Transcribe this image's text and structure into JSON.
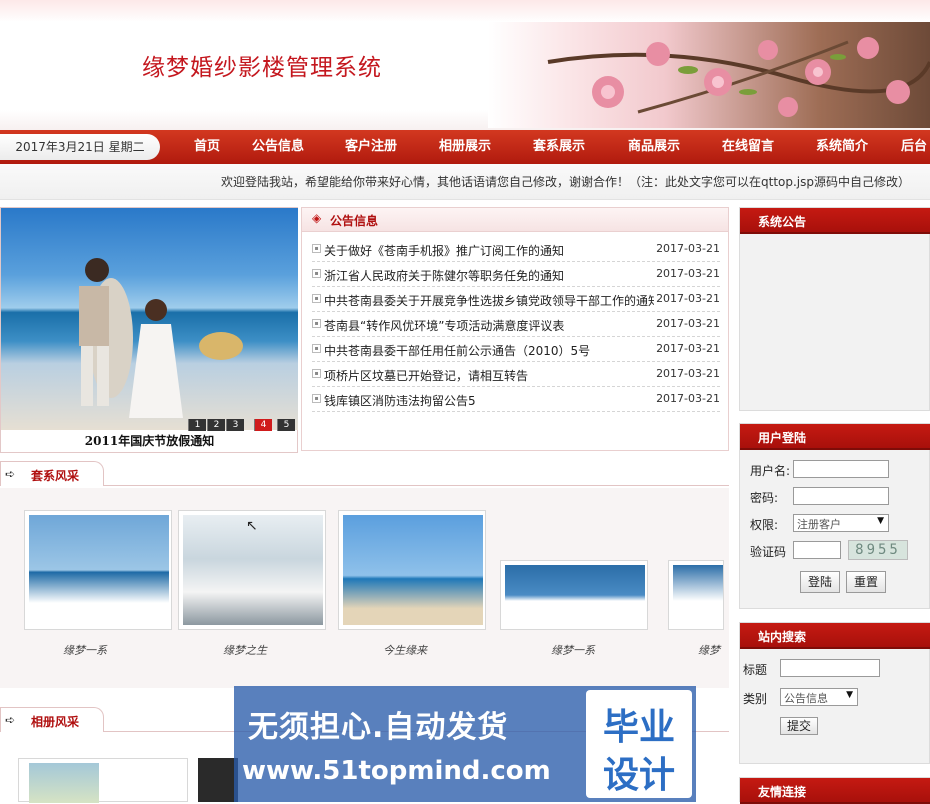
{
  "header": {
    "site_title": "缘梦婚纱影楼管理系统"
  },
  "nav": {
    "date": "2017年3月21日 星期二",
    "items": [
      "首页",
      "公告信息",
      "客户注册",
      "相册展示",
      "套系展示",
      "商品展示",
      "在线留言",
      "系统简介",
      "后台"
    ]
  },
  "notice": {
    "text": "欢迎登陆我站，希望能给你带来好心情，其他话语请您自己修改，谢谢合作！（注：此处文字您可以在qttop.jsp源码中自己修改）"
  },
  "slideshow": {
    "caption": "2011年国庆节放假通知",
    "pages": [
      "1",
      "2",
      "3",
      "4",
      "5"
    ],
    "active_page": "4"
  },
  "announcements": {
    "title": "公告信息",
    "items": [
      {
        "title": "关于做好《苍南手机报》推广订阅工作的通知",
        "date": "2017-03-21"
      },
      {
        "title": "浙江省人民政府关于陈健尔等职务任免的通知",
        "date": "2017-03-21"
      },
      {
        "title": "中共苍南县委关于开展竞争性选拔乡镇党政领导干部工作的通知",
        "date": "2017-03-21"
      },
      {
        "title": "苍南县“转作风优环境”专项活动满意度评议表",
        "date": "2017-03-21"
      },
      {
        "title": "中共苍南县委干部任用任前公示通告（2010）5号",
        "date": "2017-03-21"
      },
      {
        "title": "项桥片区坟墓已开始登记，请相互转告",
        "date": "2017-03-21"
      },
      {
        "title": "钱库镇区消防违法拘留公告5",
        "date": "2017-03-21"
      }
    ]
  },
  "packages": {
    "title": "套系风采",
    "items": [
      {
        "label": "缘梦一系"
      },
      {
        "label": "缘梦之生"
      },
      {
        "label": "今生缘来"
      },
      {
        "label": "缘梦一系"
      },
      {
        "label": "缘梦"
      }
    ]
  },
  "albums": {
    "title": "相册风采"
  },
  "sidebar": {
    "system_notice": {
      "title": "系统公告"
    },
    "login": {
      "title": "用户登陆",
      "username_label": "用户名:",
      "password_label": "密码:",
      "role_label": "权限:",
      "role_value": "注册客户",
      "captcha_label": "验证码",
      "captcha_text": "8955",
      "login_button": "登陆",
      "reset_button": "重置"
    },
    "search": {
      "title": "站内搜索",
      "title_label": "标题",
      "category_label": "类别",
      "category_value": "公告信息",
      "submit_button": "提交"
    },
    "links": {
      "title": "友情连接"
    }
  },
  "watermark": {
    "line1": "无须担心.自动发货",
    "line2": "www.51topmind.com",
    "stamp1": "毕业",
    "stamp2": "设计"
  },
  "colors": {
    "brand_red": "#c4171e",
    "nav_red": "#b01a0e",
    "watermark_blue": "#2a5caa"
  }
}
